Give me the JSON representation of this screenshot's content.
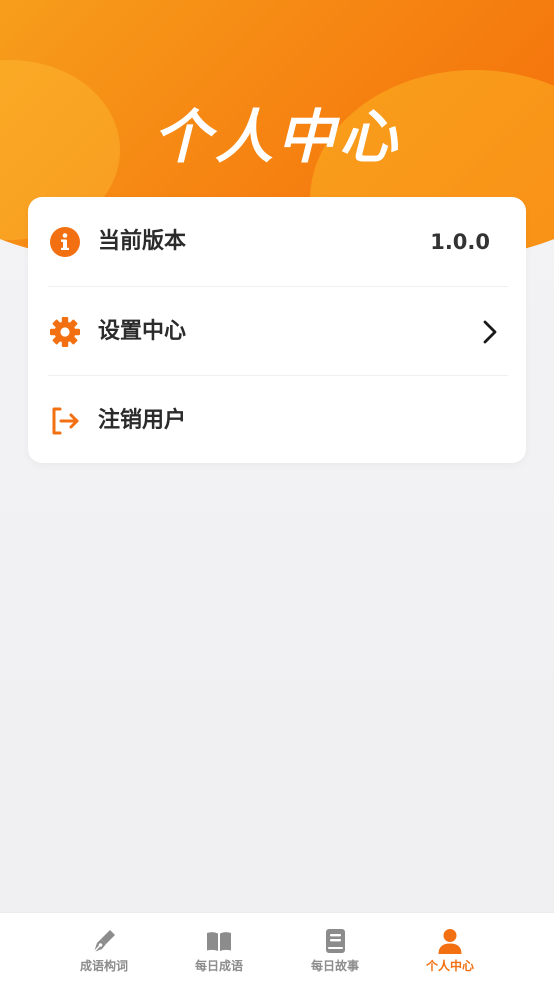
{
  "header": {
    "title": "个人中心"
  },
  "menu": {
    "items": [
      {
        "label": "当前版本",
        "value": "1.0.0",
        "icon": "info-icon"
      },
      {
        "label": "设置中心",
        "icon": "gear-icon",
        "trailing": "chevron-right-icon"
      },
      {
        "label": "注销用户",
        "icon": "logout-icon"
      }
    ]
  },
  "tabbar": {
    "active_index": 3,
    "items": [
      {
        "label": "成语构词",
        "icon": "pen-icon"
      },
      {
        "label": "每日成语",
        "icon": "open-book-icon"
      },
      {
        "label": "每日故事",
        "icon": "book-icon"
      },
      {
        "label": "个人中心",
        "icon": "user-icon"
      }
    ]
  },
  "colors": {
    "accent": "#F27011",
    "header_light": "#F7A31D",
    "header_dark": "#F36A08",
    "tab_inactive": "#8C8C8C",
    "text_primary": "#2B2B2B",
    "background": "#F2F2F4"
  }
}
